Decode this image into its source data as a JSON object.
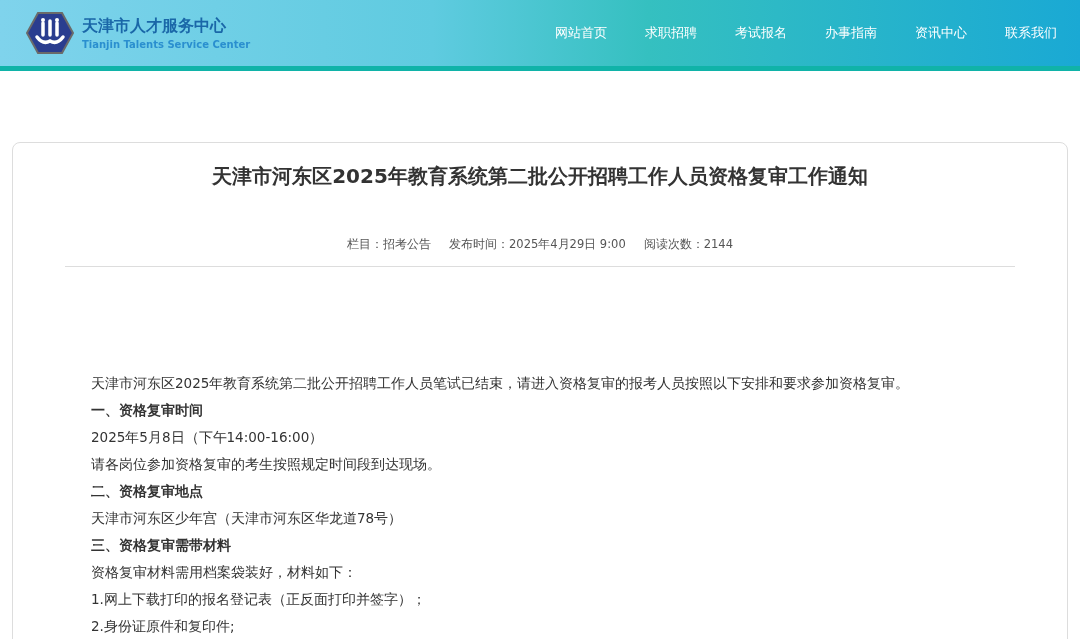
{
  "header": {
    "logo": {
      "title": "天津市人才服务中心",
      "subtitle": "Tianjin Talents Service Center"
    },
    "nav": [
      "网站首页",
      "求职招聘",
      "考试报名",
      "办事指南",
      "资讯中心",
      "联系我们"
    ]
  },
  "article": {
    "title": "天津市河东区2025年教育系统第二批公开招聘工作人员资格复审工作通知",
    "meta": [
      "栏目：招考公告",
      "发布时间：2025年4月29日 9:00",
      "阅读次数：2144"
    ],
    "paragraphs": [
      {
        "kind": "text",
        "text": "天津市河东区2025年教育系统第二批公开招聘工作人员笔试已结束，请进入资格复审的报考人员按照以下安排和要求参加资格复审。"
      },
      {
        "kind": "heading",
        "text": "一、资格复审时间"
      },
      {
        "kind": "text",
        "text": "2025年5月8日（下午14:00-16:00）"
      },
      {
        "kind": "text",
        "text": "请各岗位参加资格复审的考生按照规定时间段到达现场。"
      },
      {
        "kind": "heading",
        "text": "二、资格复审地点"
      },
      {
        "kind": "text",
        "text": "天津市河东区少年宫（天津市河东区华龙道78号）"
      },
      {
        "kind": "heading",
        "text": "三、资格复审需带材料"
      },
      {
        "kind": "text",
        "text": "资格复审材料需用档案袋装好，材料如下："
      },
      {
        "kind": "text",
        "text": "1.网上下载打印的报名登记表（正反面打印并签字）；"
      },
      {
        "kind": "text",
        "text": "2.身份证原件和复印件;"
      }
    ]
  }
}
